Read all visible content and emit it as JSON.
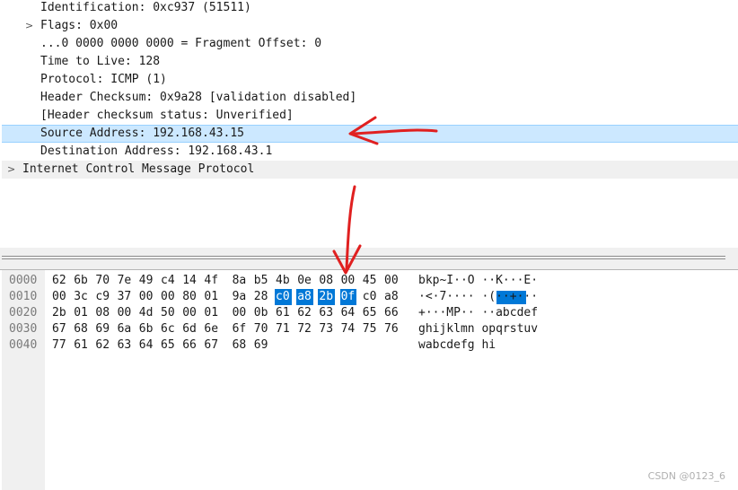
{
  "detail_tree": {
    "rows": [
      {
        "text": "Identification: 0xc937 (51511)",
        "expand": ""
      },
      {
        "text": "Flags: 0x00",
        "expand": ">"
      },
      {
        "text": "...0 0000 0000 0000 = Fragment Offset: 0",
        "expand": ""
      },
      {
        "text": "Time to Live: 128",
        "expand": ""
      },
      {
        "text": "Protocol: ICMP (1)",
        "expand": ""
      },
      {
        "text": "Header Checksum: 0x9a28 [validation disabled]",
        "expand": ""
      },
      {
        "text": "[Header checksum status: Unverified]",
        "expand": ""
      },
      {
        "text": "Source Address: 192.168.43.15",
        "expand": "",
        "selected": true
      },
      {
        "text": "Destination Address: 192.168.43.1",
        "expand": ""
      },
      {
        "text": "Internet Control Message Protocol",
        "expand": ">",
        "top_level": true
      }
    ]
  },
  "bytes": {
    "rows": [
      {
        "offset": "0000",
        "hex": [
          "62",
          "6b",
          "70",
          "7e",
          "49",
          "c4",
          "14",
          "4f",
          "8a",
          "b5",
          "4b",
          "0e",
          "08",
          "00",
          "45",
          "00"
        ],
        "ascii": "bkp~I··O ··K···E·"
      },
      {
        "offset": "0010",
        "hex": [
          "00",
          "3c",
          "c9",
          "37",
          "00",
          "00",
          "80",
          "01",
          "9a",
          "28",
          "c0",
          "a8",
          "2b",
          "0f",
          "c0",
          "a8"
        ],
        "ascii": "·<·7···· ·(··+···"
      },
      {
        "offset": "0020",
        "hex": [
          "2b",
          "01",
          "08",
          "00",
          "4d",
          "50",
          "00",
          "01",
          "00",
          "0b",
          "61",
          "62",
          "63",
          "64",
          "65",
          "66"
        ],
        "ascii": "+···MP·· ··abcdef"
      },
      {
        "offset": "0030",
        "hex": [
          "67",
          "68",
          "69",
          "6a",
          "6b",
          "6c",
          "6d",
          "6e",
          "6f",
          "70",
          "71",
          "72",
          "73",
          "74",
          "75",
          "76"
        ],
        "ascii": "ghijklmn opqrstuv"
      },
      {
        "offset": "0040",
        "hex": [
          "77",
          "61",
          "62",
          "63",
          "64",
          "65",
          "66",
          "67",
          "68",
          "69"
        ],
        "ascii": "wabcdefg hi"
      }
    ],
    "highlight": {
      "row": 1,
      "start": 10,
      "end": 13
    }
  },
  "annotation_color": "#e02020",
  "highlight_color": "#0078d7",
  "selection_color": "#cce8ff",
  "watermark": "CSDN @0123_6"
}
